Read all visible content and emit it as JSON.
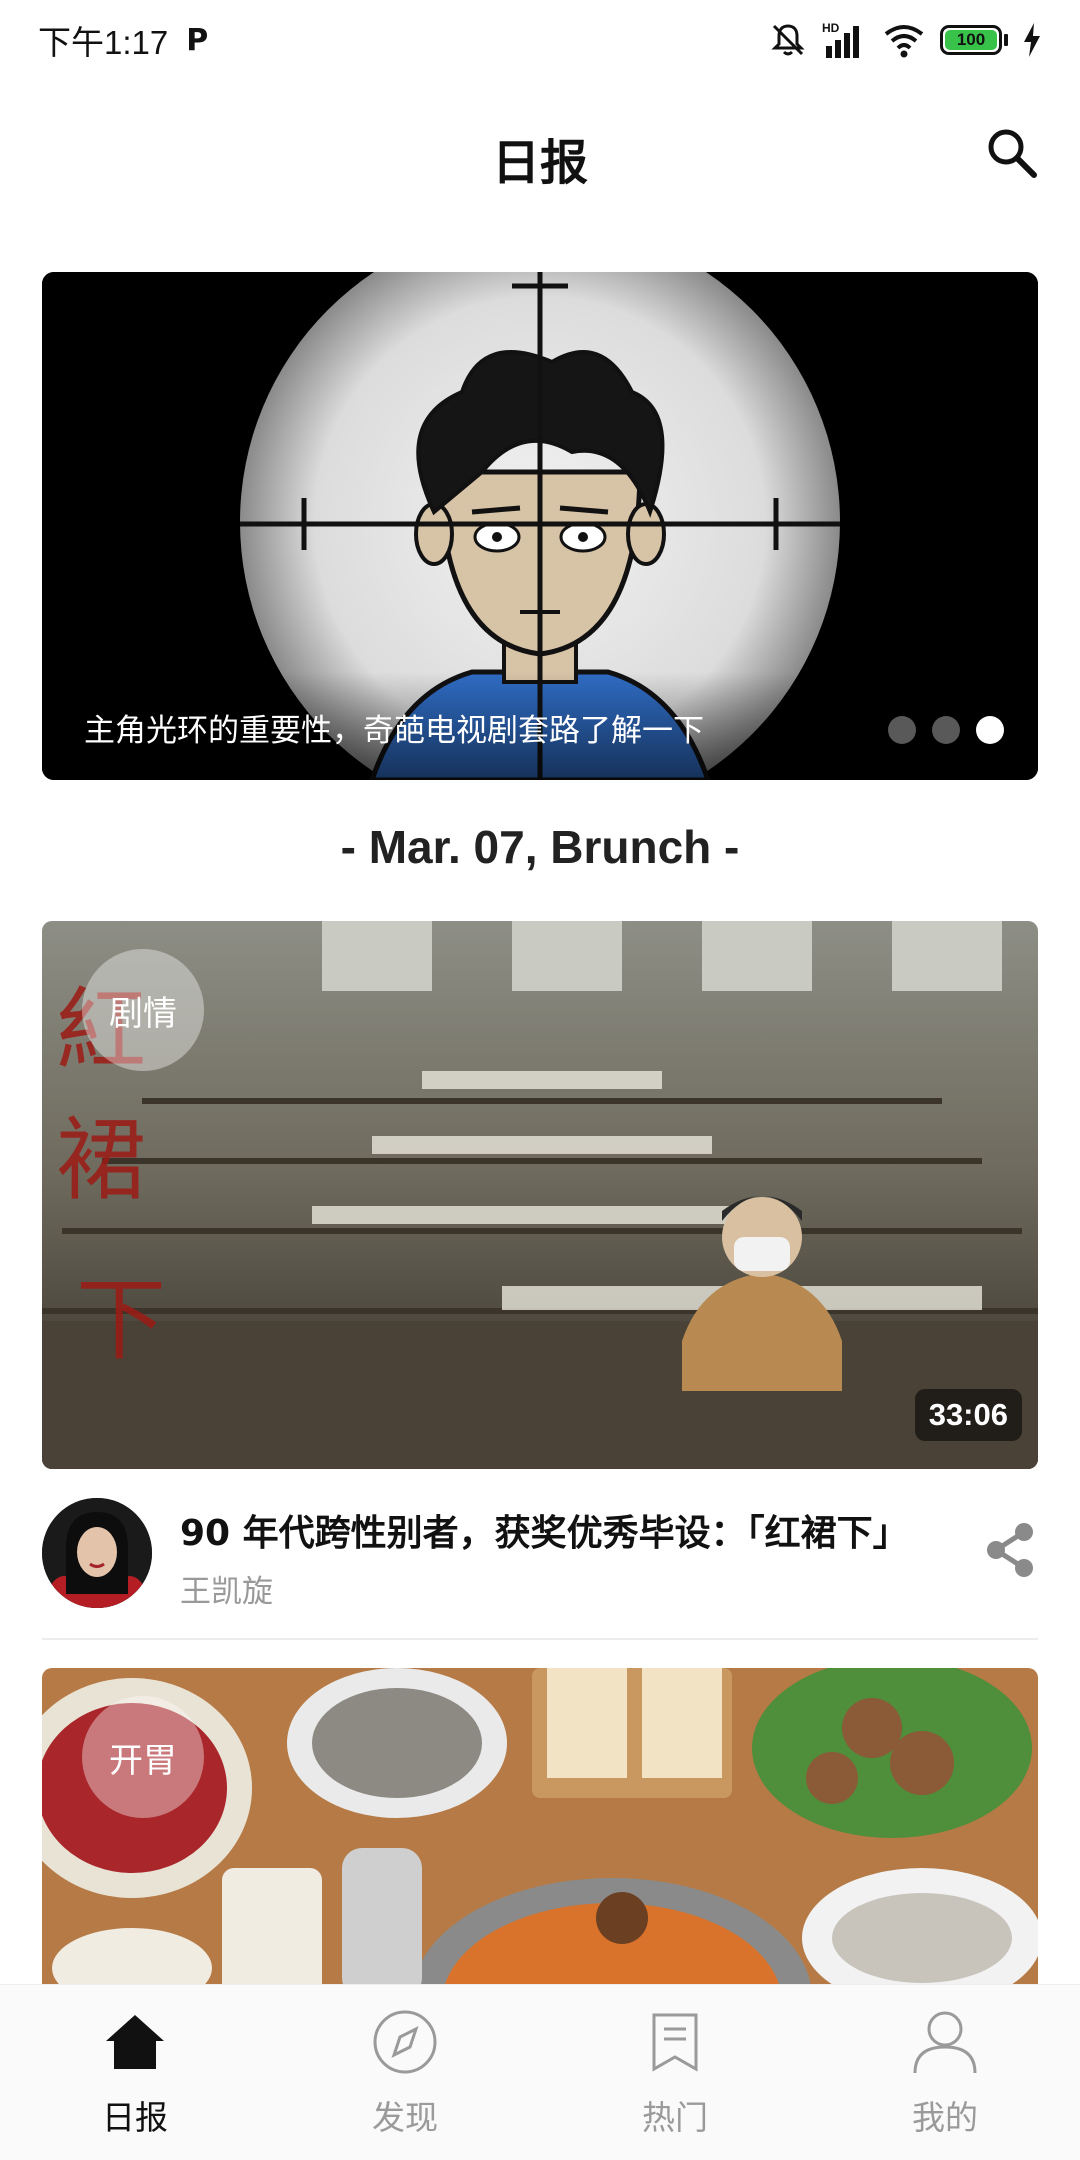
{
  "status_bar": {
    "time": "下午1:17",
    "notification_icon": "P",
    "network_label": "HD",
    "battery": "100"
  },
  "header": {
    "title": "日报"
  },
  "banner": {
    "caption": "主角光环的重要性，奇葩电视剧套路了解一下",
    "dots_count": 3,
    "active_dot": 2
  },
  "section": {
    "date_label": "- Mar. 07, Brunch -"
  },
  "feed": [
    {
      "tag": "剧情",
      "duration": "33:06",
      "title": "90 年代跨性别者，获奖优秀毕设：「红裙下」",
      "author": "王凯旋"
    },
    {
      "tag": "开胃"
    }
  ],
  "bottom_nav": [
    {
      "label": "日报",
      "icon": "home-icon",
      "active": true
    },
    {
      "label": "发现",
      "icon": "compass-icon",
      "active": false
    },
    {
      "label": "热门",
      "icon": "bookmark-icon",
      "active": false
    },
    {
      "label": "我的",
      "icon": "person-icon",
      "active": false
    }
  ]
}
